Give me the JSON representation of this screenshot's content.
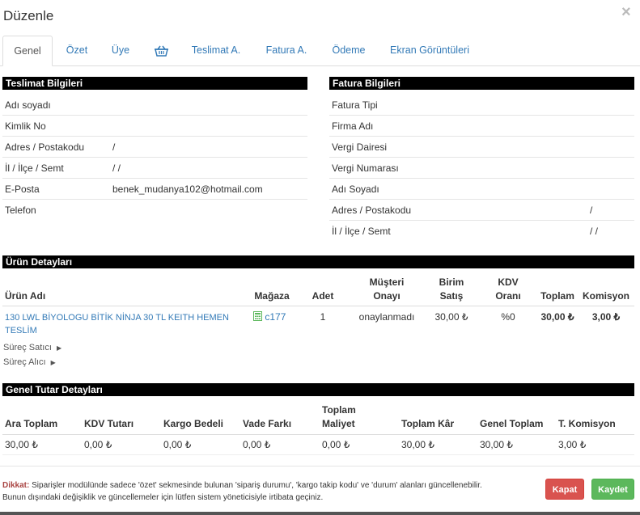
{
  "modal": {
    "title": "Düzenle",
    "close": "×"
  },
  "tabs": [
    {
      "label": "Genel"
    },
    {
      "label": "Özet"
    },
    {
      "label": "Üye"
    },
    {
      "label": ""
    },
    {
      "label": "Teslimat A."
    },
    {
      "label": "Fatura A."
    },
    {
      "label": "Ödeme"
    },
    {
      "label": "Ekran Görüntüleri"
    }
  ],
  "teslimat": {
    "title": "Teslimat Bilgileri",
    "rows": [
      {
        "label": "Adı soyadı",
        "value": ""
      },
      {
        "label": "Kimlik No",
        "value": ""
      },
      {
        "label": "Adres / Postakodu",
        "value": "/"
      },
      {
        "label": "İl / İlçe / Semt",
        "value": "/ /"
      },
      {
        "label": "E-Posta",
        "value": "benek_mudanya102@hotmail.com"
      },
      {
        "label": "Telefon",
        "value": ""
      }
    ]
  },
  "fatura": {
    "title": "Fatura Bilgileri",
    "rows": [
      {
        "label": "Fatura Tipi",
        "value": ""
      },
      {
        "label": "Firma Adı",
        "value": ""
      },
      {
        "label": "Vergi Dairesi",
        "value": ""
      },
      {
        "label": "Vergi Numarası",
        "value": ""
      },
      {
        "label": "Adı Soyadı",
        "value": ""
      },
      {
        "label": "Adres / Postakodu",
        "value": "/"
      },
      {
        "label": "İl / İlçe / Semt",
        "value": "/ /"
      }
    ]
  },
  "urun": {
    "title": "Ürün Detayları",
    "headers": {
      "urun_adi": "Ürün Adı",
      "magaza": "Mağaza",
      "adet": "Adet",
      "musteri_1": "Müşteri",
      "musteri_2": "Onayı",
      "birim_1": "Birim",
      "birim_2": "Satış",
      "kdv_1": "KDV",
      "kdv_2": "Oranı",
      "toplam": "Toplam",
      "komisyon": "Komisyon"
    },
    "row": {
      "name_1": "130 LWL BİYOLOGU BİTİK NİNJA 30 TL KEITH HEMEN",
      "name_2": "TESLİM",
      "magaza": "c177",
      "adet": "1",
      "onay": "onaylanmadı",
      "birim": "30,00 ₺",
      "kdv": "%0",
      "toplam": "30,00 ₺",
      "komisyon": "3,00 ₺"
    },
    "surec_satici": "Süreç Satıcı",
    "surec_alici": "Süreç Alıcı"
  },
  "genel": {
    "title": "Genel Tutar Detayları",
    "headers": [
      {
        "l1": "",
        "l2": "Ara Toplam"
      },
      {
        "l1": "",
        "l2": "KDV Tutarı"
      },
      {
        "l1": "",
        "l2": "Kargo Bedeli"
      },
      {
        "l1": "",
        "l2": "Vade Farkı"
      },
      {
        "l1": "Toplam",
        "l2": "Maliyet"
      },
      {
        "l1": "",
        "l2": "Toplam Kâr"
      },
      {
        "l1": "",
        "l2": "Genel Toplam"
      },
      {
        "l1": "",
        "l2": "T. Komisyon"
      }
    ],
    "values": [
      "30,00 ₺",
      "0,00 ₺",
      "0,00 ₺",
      "0,00 ₺",
      "0,00 ₺",
      "30,00 ₺",
      "30,00 ₺",
      "3,00 ₺"
    ]
  },
  "footer": {
    "note_label": "Dikkat:",
    "note_line1": "Siparişler modülünde sadece 'özet' sekmesinde bulunan 'sipariş durumu', 'kargo takip kodu' ve 'durum' alanları güncellenebilir.",
    "note_line2": "Bunun dışındaki değişiklik ve güncellemeler için lütfen sistem yöneticisiyle irtibata geçiniz.",
    "kapat": "Kapat",
    "kaydet": "Kaydet"
  },
  "colors": {
    "link": "#337ab7",
    "danger": "#d9534f",
    "success": "#5cb85c"
  }
}
